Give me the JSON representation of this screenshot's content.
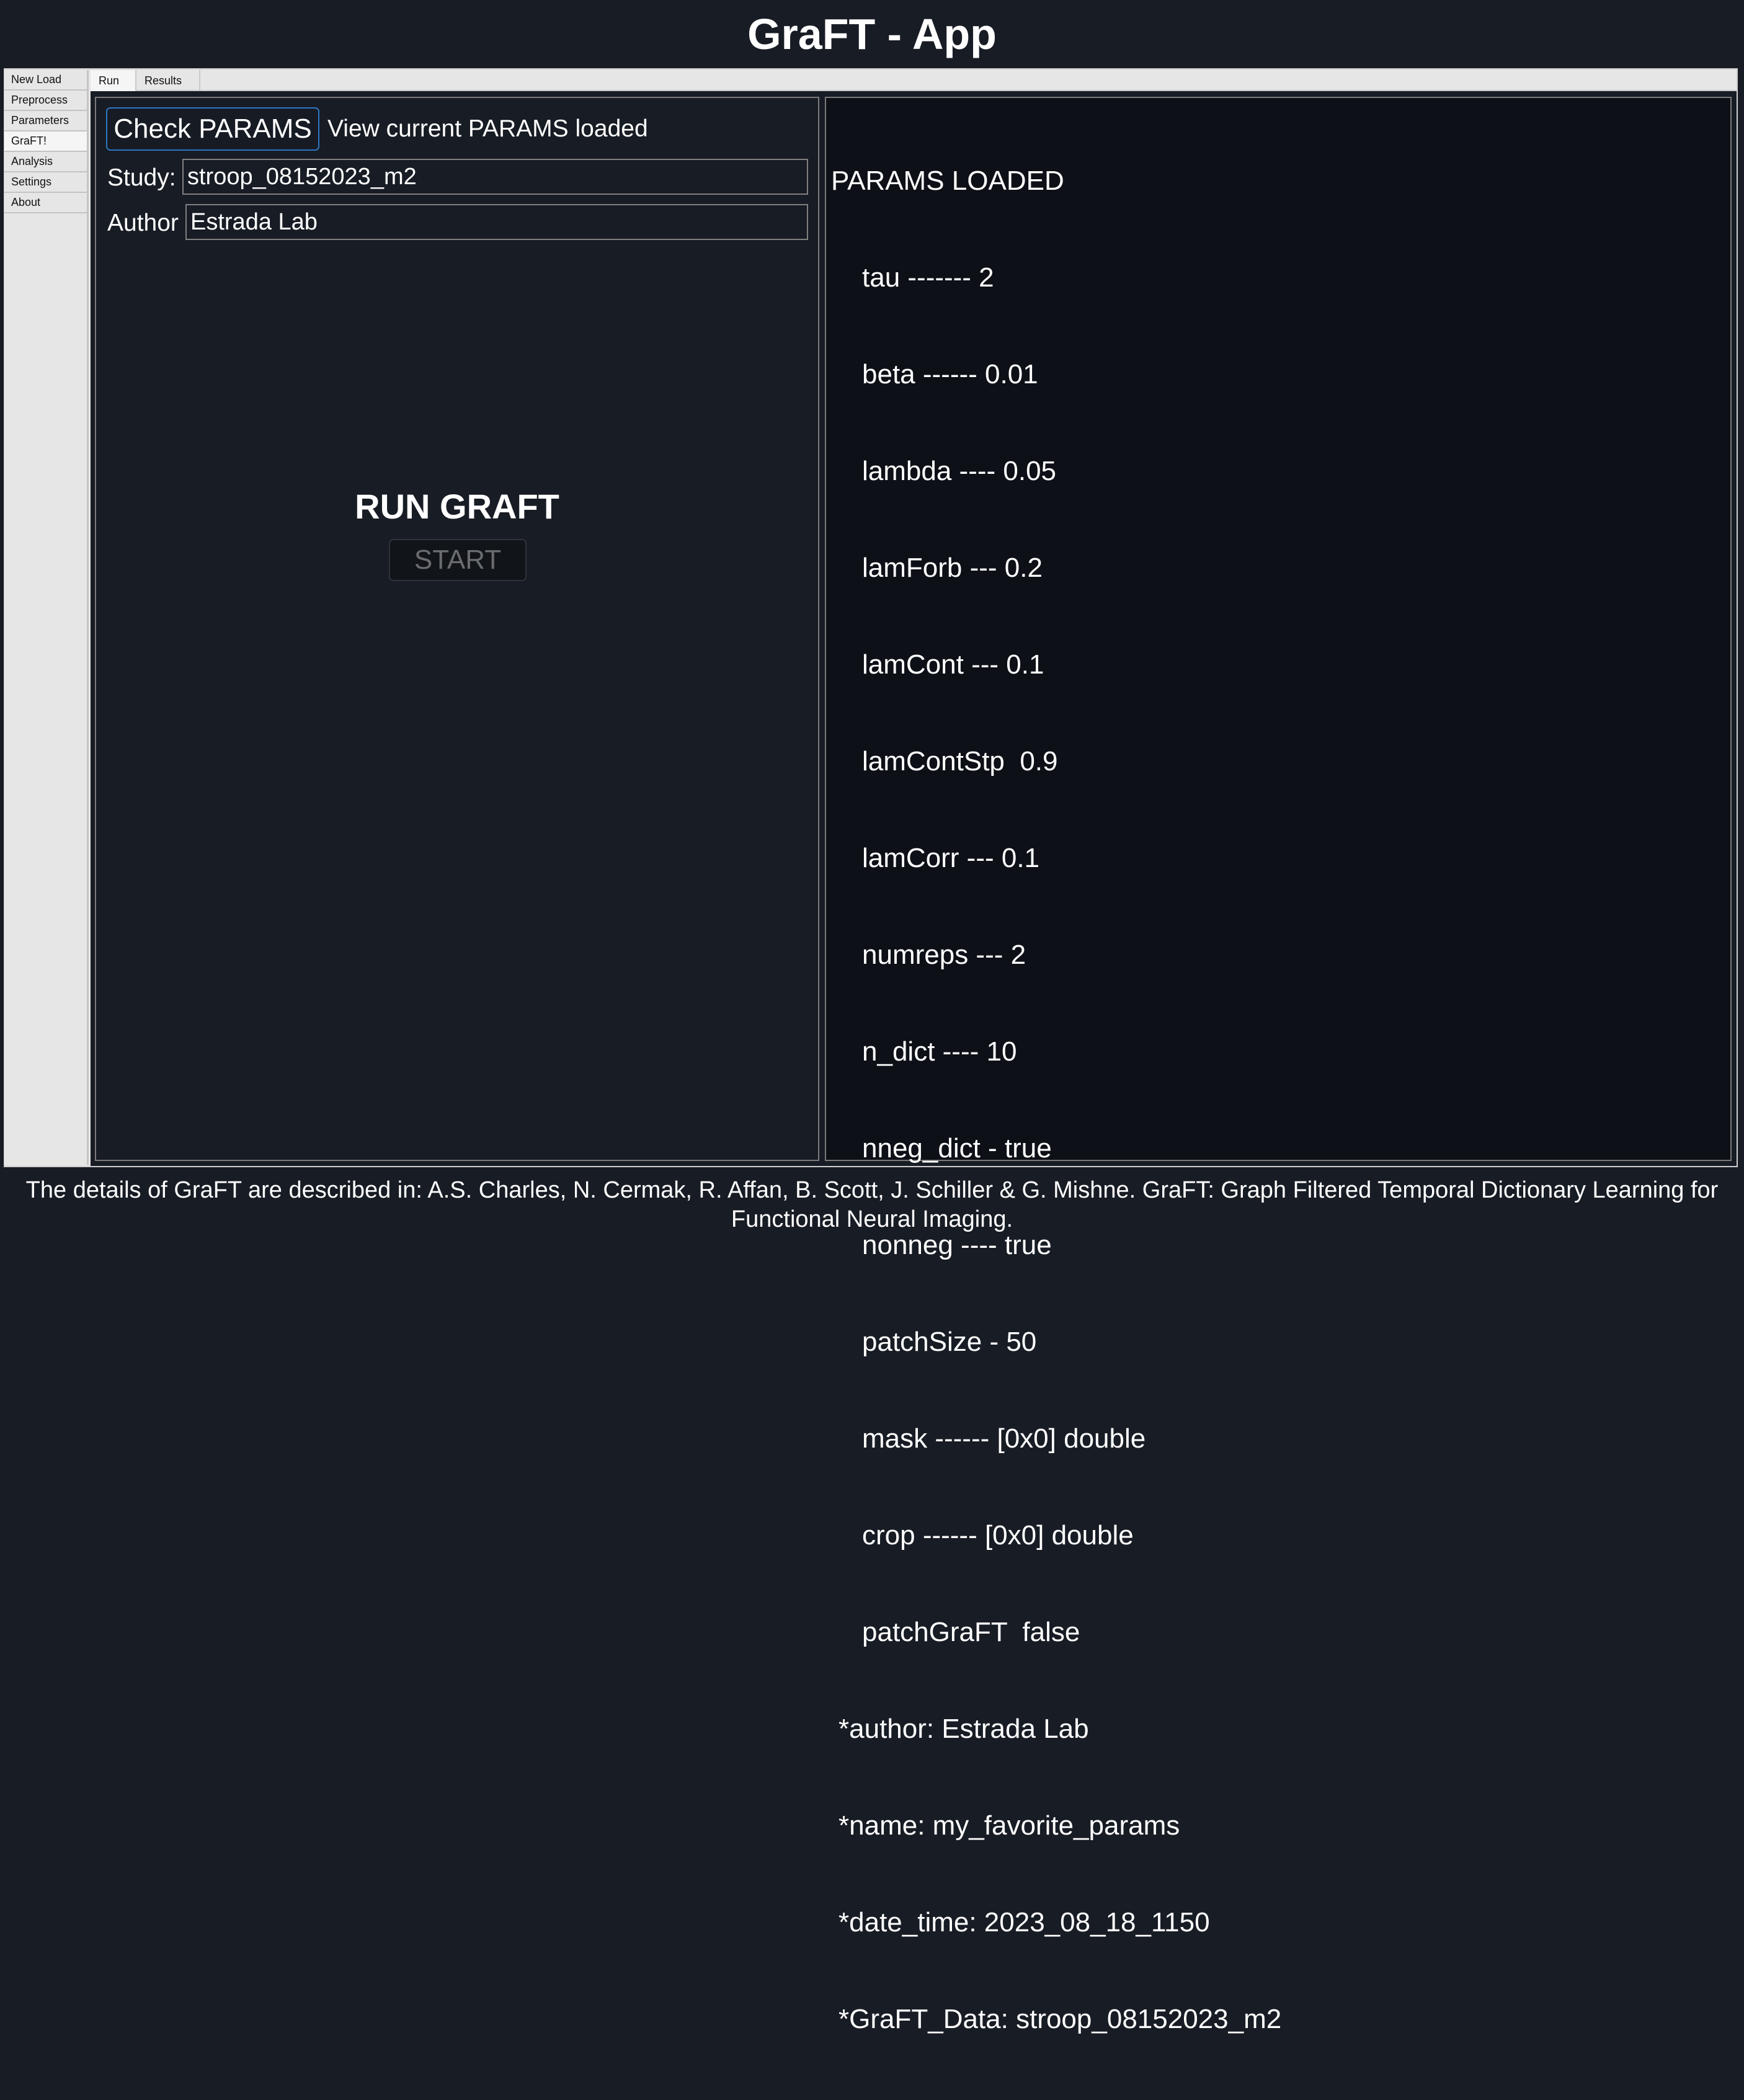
{
  "header": {
    "title": "GraFT - App"
  },
  "sidebar": {
    "items": [
      {
        "label": "New Load"
      },
      {
        "label": "Preprocess"
      },
      {
        "label": "Parameters"
      },
      {
        "label": "GraFT!",
        "active": true
      },
      {
        "label": "Analysis"
      },
      {
        "label": "Settings"
      },
      {
        "label": "About"
      }
    ]
  },
  "tabs": [
    {
      "label": "Run",
      "active": true
    },
    {
      "label": "Results"
    }
  ],
  "run_panel": {
    "check_params_button": "Check PARAMS",
    "check_params_desc": "View current PARAMS loaded",
    "study_label": "Study:",
    "study_value": "stroop_08152023_m2",
    "author_label": "Author",
    "author_value": "Estrada Lab",
    "run_title": "RUN GRAFT",
    "start_button": "START"
  },
  "params_panel": {
    "heading": "PARAMS LOADED",
    "params": [
      "tau ------- 2",
      "beta ------ 0.01",
      "lambda ---- 0.05",
      "lamForb --- 0.2",
      "lamCont --- 0.1",
      "lamContStp  0.9",
      "lamCorr --- 0.1",
      "numreps --- 2",
      "n_dict ---- 10",
      "nneg_dict - true",
      "nonneg ---- true",
      "patchSize - 50",
      "mask ------ [0x0] double",
      "crop ------ [0x0] double",
      "patchGraFT  false"
    ],
    "meta": [
      "*author: Estrada Lab",
      "*name: my_favorite_params",
      "*date_time: 2023_08_18_1150",
      "*GraFT_Data: stroop_08152023_m2"
    ]
  },
  "footer": {
    "line1": "The details of GraFT are described in: A.S. Charles, N. Cermak, R. Affan, B. Scott, J. Schiller & G. Mishne. GraFT: Graph Filtered Temporal Dictionary Learning for",
    "line2": "Functional Neural Imaging."
  }
}
